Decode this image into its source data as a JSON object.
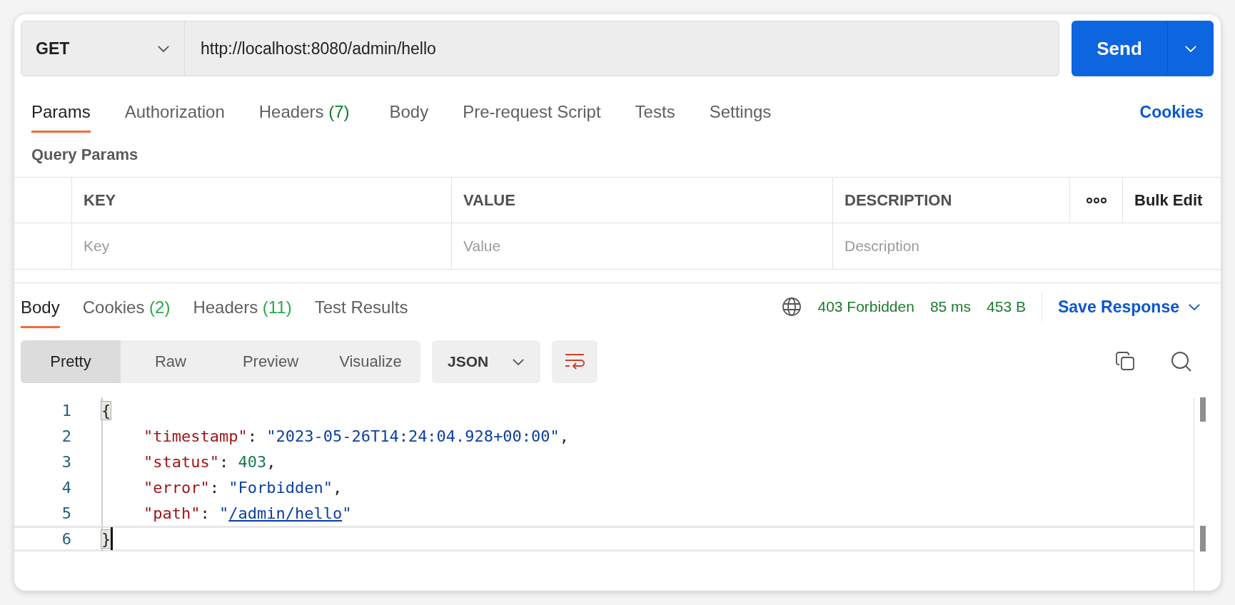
{
  "request": {
    "method": "GET",
    "url": "http://localhost:8080/admin/hello",
    "send_label": "Send"
  },
  "request_tabs": [
    {
      "label": "Params",
      "selected": true
    },
    {
      "label": "Authorization",
      "selected": false
    },
    {
      "label": "Headers",
      "count": "(7)",
      "selected": false
    },
    {
      "label": "Body",
      "selected": false
    },
    {
      "label": "Pre-request Script",
      "selected": false
    },
    {
      "label": "Tests",
      "selected": false
    },
    {
      "label": "Settings",
      "selected": false
    }
  ],
  "cookies_link": "Cookies",
  "query_params": {
    "title": "Query Params",
    "columns": [
      "KEY",
      "VALUE",
      "DESCRIPTION"
    ],
    "bulk_edit": "Bulk Edit",
    "placeholders": [
      "Key",
      "Value",
      "Description"
    ]
  },
  "response_tabs": [
    {
      "label": "Body",
      "selected": true
    },
    {
      "label": "Cookies",
      "count": "(2)",
      "selected": false
    },
    {
      "label": "Headers",
      "count": "(11)",
      "selected": false
    },
    {
      "label": "Test Results",
      "selected": false
    }
  ],
  "response_status": {
    "status": "403 Forbidden",
    "time": "85 ms",
    "size": "453 B",
    "save_label": "Save Response"
  },
  "view_modes": [
    {
      "label": "Pretty",
      "selected": true
    },
    {
      "label": "Raw",
      "selected": false
    },
    {
      "label": "Preview",
      "selected": false
    },
    {
      "label": "Visualize",
      "selected": false
    }
  ],
  "format": "JSON",
  "code_lines": [
    {
      "number": "1",
      "current": false,
      "indent": false,
      "tokens": [
        {
          "kind": "bracket",
          "text": "{"
        }
      ]
    },
    {
      "number": "2",
      "current": false,
      "indent": true,
      "tokens": [
        {
          "kind": "key",
          "text": "\"timestamp\""
        },
        {
          "kind": "punct",
          "text": ": "
        },
        {
          "kind": "string",
          "text": "\"2023-05-26T14:24:04.928+00:00\""
        },
        {
          "kind": "punct",
          "text": ","
        }
      ]
    },
    {
      "number": "3",
      "current": false,
      "indent": true,
      "tokens": [
        {
          "kind": "key",
          "text": "\"status\""
        },
        {
          "kind": "punct",
          "text": ": "
        },
        {
          "kind": "number",
          "text": "403"
        },
        {
          "kind": "punct",
          "text": ","
        }
      ]
    },
    {
      "number": "4",
      "current": false,
      "indent": true,
      "tokens": [
        {
          "kind": "key",
          "text": "\"error\""
        },
        {
          "kind": "punct",
          "text": ": "
        },
        {
          "kind": "string",
          "text": "\"Forbidden\""
        },
        {
          "kind": "punct",
          "text": ","
        }
      ]
    },
    {
      "number": "5",
      "current": false,
      "indent": true,
      "tokens": [
        {
          "kind": "key",
          "text": "\"path\""
        },
        {
          "kind": "punct",
          "text": ": "
        },
        {
          "kind": "string",
          "text": "\""
        },
        {
          "kind": "link",
          "text": "/admin/hello"
        },
        {
          "kind": "string",
          "text": "\""
        }
      ]
    },
    {
      "number": "6",
      "current": true,
      "indent": false,
      "tokens": [
        {
          "kind": "bracket",
          "text": "}"
        }
      ]
    }
  ]
}
